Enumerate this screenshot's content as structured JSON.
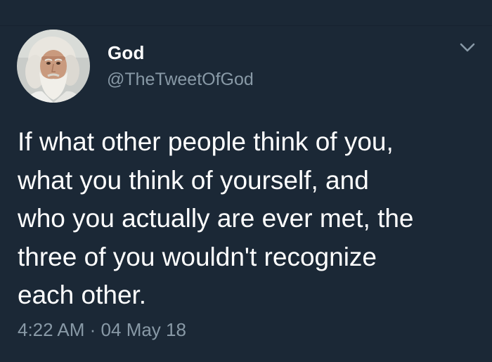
{
  "tweet": {
    "author": {
      "display_name": "God",
      "handle": "@TheTweetOfGod",
      "avatar_icon": "bearded-man-avatar"
    },
    "menu_icon": "chevron-down-icon",
    "text": "If what other people think of you,\nwhat you think of yourself, and\nwho you actually are ever met, the\nthree of you wouldn't recognize\neach other.",
    "time": "4:22 AM",
    "separator": "·",
    "date": "04 May 18"
  },
  "colors": {
    "background": "#1b2836",
    "primary_text": "#ffffff",
    "secondary_text": "#8899a6"
  }
}
